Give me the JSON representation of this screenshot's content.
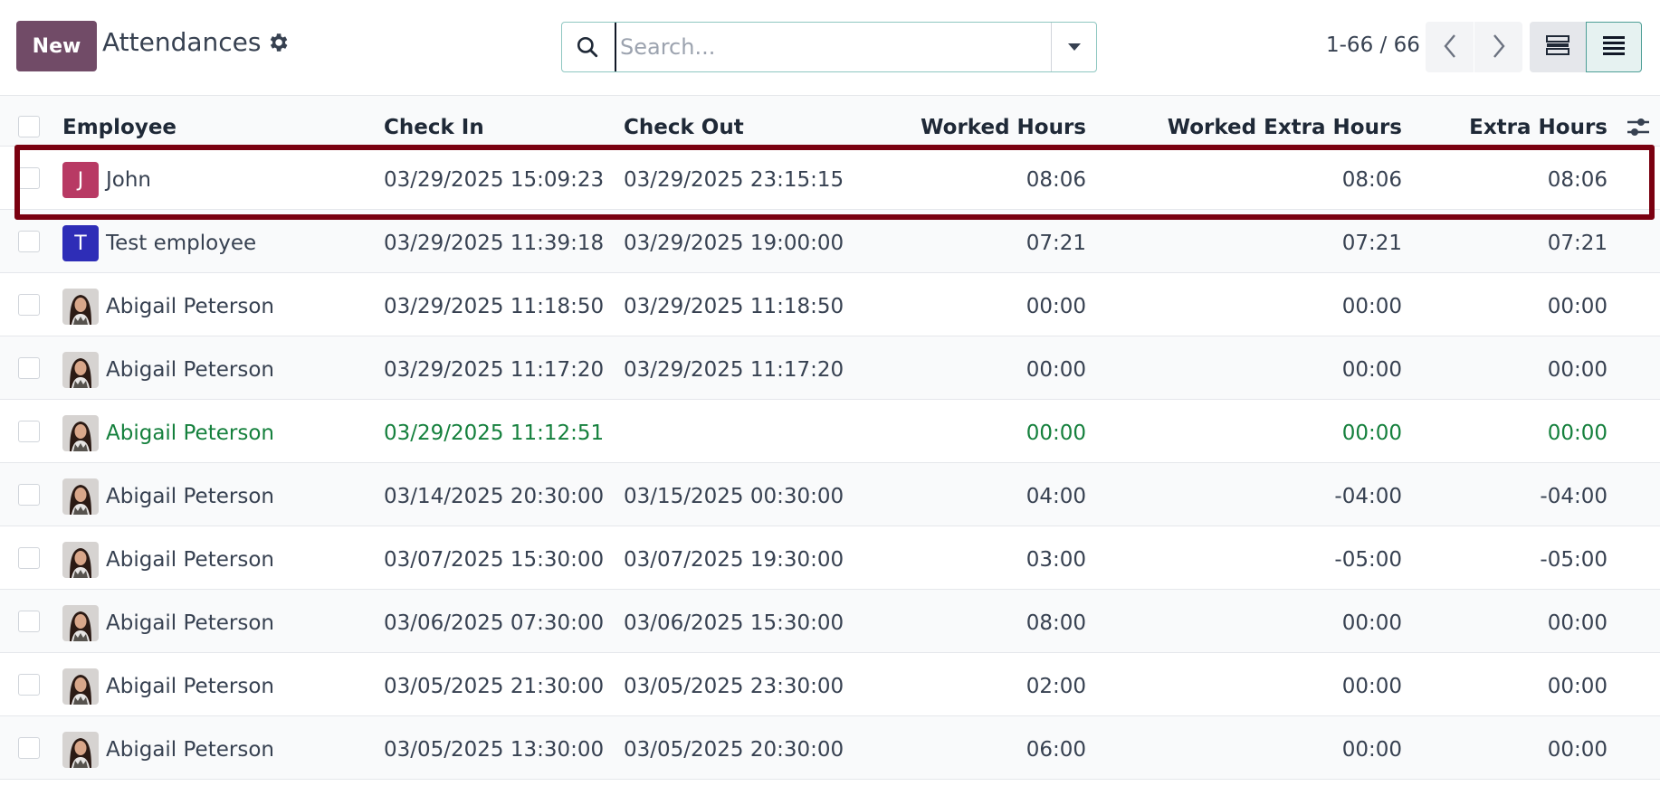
{
  "header": {
    "new_label": "New",
    "title": "Attendances",
    "search_placeholder": "Search...",
    "pager": "1-66 / 66"
  },
  "colors": {
    "brand": "#714b67",
    "highlight": "#7a0010",
    "active_row_text": "#15803d"
  },
  "icons": {
    "settings": "gear-icon",
    "search": "search-icon",
    "dropdown": "caret-down-icon",
    "prev": "chevron-left-icon",
    "next": "chevron-right-icon",
    "kanban": "kanban-view-icon",
    "list": "list-view-icon",
    "columns": "optional-columns-icon"
  },
  "table": {
    "columns": [
      "Employee",
      "Check In",
      "Check Out",
      "Worked Hours",
      "Worked Extra Hours",
      "Extra Hours"
    ],
    "rows": [
      {
        "employee": "John",
        "avatar": {
          "type": "letter",
          "letter": "J",
          "color": "#b83a64"
        },
        "check_in": "03/29/2025 15:09:23",
        "check_out": "03/29/2025 23:15:15",
        "worked_hours": "08:06",
        "worked_extra_hours": "08:06",
        "extra_hours": "08:06",
        "status": "normal"
      },
      {
        "employee": "Test employee",
        "avatar": {
          "type": "letter",
          "letter": "T",
          "color": "#2e2db7"
        },
        "check_in": "03/29/2025 11:39:18",
        "check_out": "03/29/2025 19:00:00",
        "worked_hours": "07:21",
        "worked_extra_hours": "07:21",
        "extra_hours": "07:21",
        "status": "normal"
      },
      {
        "employee": "Abigail Peterson",
        "avatar": {
          "type": "photo"
        },
        "check_in": "03/29/2025 11:18:50",
        "check_out": "03/29/2025 11:18:50",
        "worked_hours": "00:00",
        "worked_extra_hours": "00:00",
        "extra_hours": "00:00",
        "status": "normal"
      },
      {
        "employee": "Abigail Peterson",
        "avatar": {
          "type": "photo"
        },
        "check_in": "03/29/2025 11:17:20",
        "check_out": "03/29/2025 11:17:20",
        "worked_hours": "00:00",
        "worked_extra_hours": "00:00",
        "extra_hours": "00:00",
        "status": "normal"
      },
      {
        "employee": "Abigail Peterson",
        "avatar": {
          "type": "photo"
        },
        "check_in": "03/29/2025 11:12:51",
        "check_out": "",
        "worked_hours": "00:00",
        "worked_extra_hours": "00:00",
        "extra_hours": "00:00",
        "status": "open"
      },
      {
        "employee": "Abigail Peterson",
        "avatar": {
          "type": "photo"
        },
        "check_in": "03/14/2025 20:30:00",
        "check_out": "03/15/2025 00:30:00",
        "worked_hours": "04:00",
        "worked_extra_hours": "-04:00",
        "extra_hours": "-04:00",
        "status": "normal"
      },
      {
        "employee": "Abigail Peterson",
        "avatar": {
          "type": "photo"
        },
        "check_in": "03/07/2025 15:30:00",
        "check_out": "03/07/2025 19:30:00",
        "worked_hours": "03:00",
        "worked_extra_hours": "-05:00",
        "extra_hours": "-05:00",
        "status": "normal"
      },
      {
        "employee": "Abigail Peterson",
        "avatar": {
          "type": "photo"
        },
        "check_in": "03/06/2025 07:30:00",
        "check_out": "03/06/2025 15:30:00",
        "worked_hours": "08:00",
        "worked_extra_hours": "00:00",
        "extra_hours": "00:00",
        "status": "normal"
      },
      {
        "employee": "Abigail Peterson",
        "avatar": {
          "type": "photo"
        },
        "check_in": "03/05/2025 21:30:00",
        "check_out": "03/05/2025 23:30:00",
        "worked_hours": "02:00",
        "worked_extra_hours": "00:00",
        "extra_hours": "00:00",
        "status": "normal"
      },
      {
        "employee": "Abigail Peterson",
        "avatar": {
          "type": "photo"
        },
        "check_in": "03/05/2025 13:30:00",
        "check_out": "03/05/2025 20:30:00",
        "worked_hours": "06:00",
        "worked_extra_hours": "00:00",
        "extra_hours": "00:00",
        "status": "normal"
      }
    ]
  }
}
